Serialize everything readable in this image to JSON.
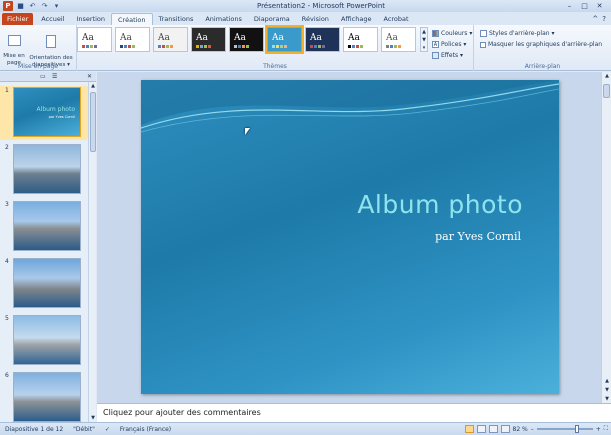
{
  "window": {
    "title": "Présentation2 - Microsoft PowerPoint",
    "app_badge": "P",
    "help_icon": "?",
    "help_arrow": "^"
  },
  "tabs": [
    {
      "label": "Fichier"
    },
    {
      "label": "Accueil"
    },
    {
      "label": "Insertion"
    },
    {
      "label": "Création"
    },
    {
      "label": "Transitions"
    },
    {
      "label": "Animations"
    },
    {
      "label": "Diaporama"
    },
    {
      "label": "Révision"
    },
    {
      "label": "Affichage"
    },
    {
      "label": "Acrobat"
    }
  ],
  "ribbon": {
    "page_setup": {
      "label": "Mise en page",
      "btn_setup": "Mise en\npage",
      "btn_orientation": "Orientation des\ndiapositives ▾"
    },
    "themes": {
      "label": "Thèmes",
      "sample": "Aa",
      "items": [
        {
          "bg": "#ffffff",
          "fg": "#333333",
          "dots": [
            "#c0504d",
            "#4f81bd",
            "#9bbb59",
            "#8064a2"
          ]
        },
        {
          "bg": "#ffffff",
          "fg": "#444444",
          "dots": [
            "#1f497d",
            "#4f81bd",
            "#c0504d",
            "#9bbb59"
          ]
        },
        {
          "bg": "#f2f2f2",
          "fg": "#444444",
          "dots": [
            "#4f81bd",
            "#c0504d",
            "#9bbb59",
            "#f79646"
          ]
        },
        {
          "bg": "#2b2b2b",
          "fg": "#ffffff",
          "dots": [
            "#e6b200",
            "#7fa3d0",
            "#a2c05d",
            "#d95b43"
          ]
        },
        {
          "bg": "#111111",
          "fg": "#ffffff",
          "dots": [
            "#c0c0c0",
            "#4f81bd",
            "#f79646",
            "#9bbb59"
          ]
        },
        {
          "bg": "#3a9ac9",
          "fg": "#ffffff",
          "dots": [
            "#8fe3ec",
            "#ffd966",
            "#a9d18e",
            "#f4b183"
          ]
        },
        {
          "bg": "#1f3359",
          "fg": "#ffffff",
          "dots": [
            "#c0504d",
            "#4f81bd",
            "#9bbb59",
            "#8064a2"
          ]
        },
        {
          "bg": "#ffffff",
          "fg": "#000000",
          "dots": [
            "#000000",
            "#4f81bd",
            "#c0504d",
            "#9bbb59"
          ]
        },
        {
          "bg": "#ffffff",
          "fg": "#555555",
          "dots": [
            "#7f7f7f",
            "#4f81bd",
            "#9bbb59",
            "#f79646"
          ]
        }
      ],
      "selected_index": 5
    },
    "theme_options": {
      "colors": "Couleurs ▾",
      "fonts": "Polices ▾",
      "effects": "Effets ▾"
    },
    "background": {
      "label": "Arrière-plan",
      "styles": "Styles d'arrière-plan ▾",
      "hide_graphics": "Masquer les graphiques d'arrière-plan"
    }
  },
  "thumbnails": [
    {
      "num": "1",
      "kind": "title",
      "selected": true
    },
    {
      "num": "2",
      "kind": "photo"
    },
    {
      "num": "3",
      "kind": "photo"
    },
    {
      "num": "4",
      "kind": "photo"
    },
    {
      "num": "5",
      "kind": "photo"
    },
    {
      "num": "6",
      "kind": "photo"
    }
  ],
  "slide": {
    "title": "Album photo",
    "subtitle": "par Yves Cornil"
  },
  "notes": {
    "placeholder": "Cliquez pour ajouter des commentaires"
  },
  "status": {
    "slide_info": "Diapositive 1 de 12",
    "theme_name": "\"Débit\"",
    "language": "Français (France)",
    "zoom": "82 %"
  }
}
